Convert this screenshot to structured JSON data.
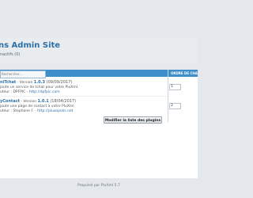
{
  "header": {
    "title": "ns Admin Site",
    "subtitle": "nactifs (0)"
  },
  "toolbar": {
    "search_placeholder": "Rechercher...",
    "column_order": "ORDRE DE CHA"
  },
  "plugins": [
    {
      "name": "niTchat",
      "version_label": " - Version ",
      "version": "1.0.3",
      "date": " (09/09/2017)",
      "desc": "joute un service de tchat pour votre PluXml.",
      "author": "uteur : DPFPIC - ",
      "link": "http://dpfpic.com",
      "order": "1"
    },
    {
      "name": "yContact",
      "version_label": " - Version ",
      "version": "1.0.1",
      "date": " (18/04/2017)",
      "desc": "joute une page de contact à votre PluXml",
      "author": "uteur : Stephane F. - ",
      "link": "http://pluxopolis.net",
      "order": "2"
    }
  ],
  "actions": {
    "update_label": "Modifier la liste des plugins"
  },
  "footer": {
    "text": "Propulsé par PluXml 5.7"
  },
  "colors": {
    "accent": "#3d8ec9",
    "link": "#2b6fa8",
    "background": "#e4e8ec"
  }
}
